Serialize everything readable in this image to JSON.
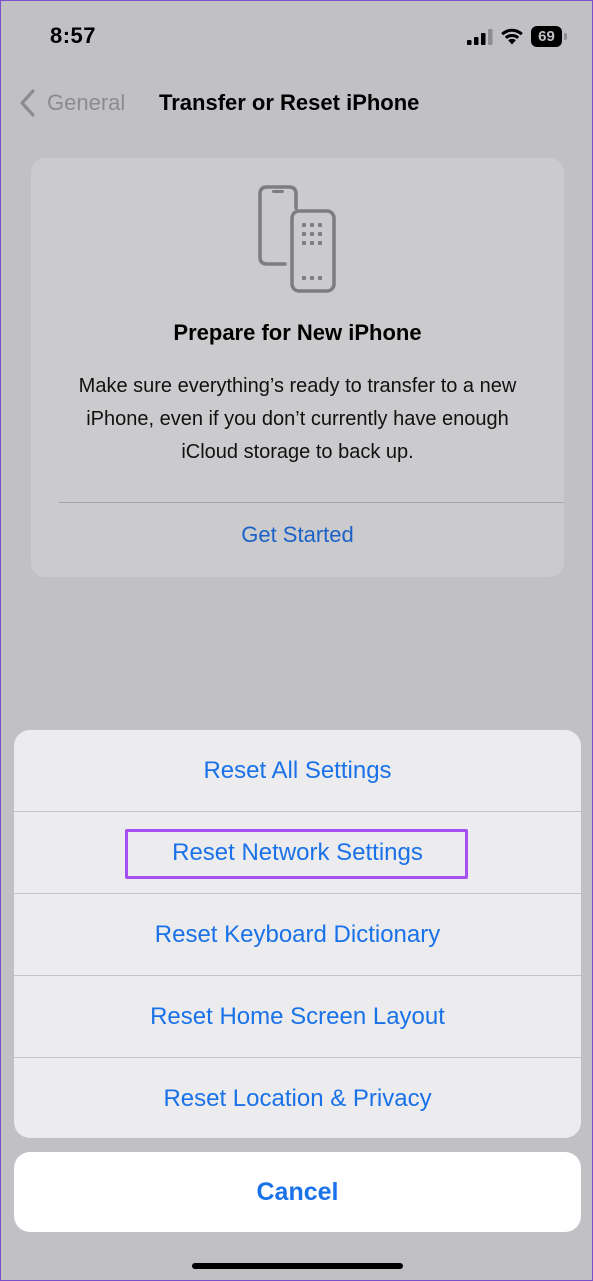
{
  "status_bar": {
    "time": "8:57",
    "battery": "69",
    "icons": [
      "signal-icon",
      "wifi-icon",
      "battery-icon"
    ]
  },
  "nav": {
    "back_label": "General",
    "title": "Transfer or Reset iPhone"
  },
  "prepare_card": {
    "icon": "phones-transfer-icon",
    "title": "Prepare for New iPhone",
    "description": "Make sure everything’s ready to transfer to a new iPhone, even if you don’t currently have enough iCloud storage to back up.",
    "action": "Get Started"
  },
  "action_sheet": {
    "items": [
      {
        "label": "Reset All Settings"
      },
      {
        "label": "Reset Network Settings",
        "highlighted": true
      },
      {
        "label": "Reset Keyboard Dictionary"
      },
      {
        "label": "Reset Home Screen Layout"
      },
      {
        "label": "Reset Location & Privacy"
      }
    ],
    "cancel": "Cancel"
  },
  "colors": {
    "accent": "#1a72e8",
    "highlight": "#a64ff0",
    "dimmed_background": "#c1c0c4"
  }
}
